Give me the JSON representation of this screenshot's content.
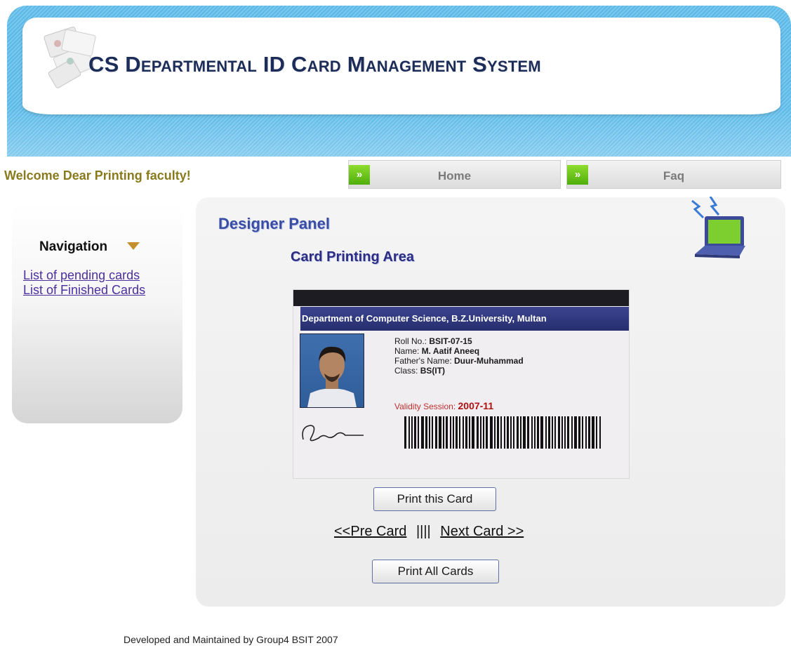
{
  "header": {
    "title": "CS Departmental ID Card Management System"
  },
  "welcome": "Welcome Dear Printing faculty!",
  "topnav": [
    {
      "label": "Home"
    },
    {
      "label": "Faq"
    }
  ],
  "sidebar": {
    "title": "Navigation",
    "links": [
      "List of pending cards",
      "List of Finished Cards"
    ]
  },
  "main": {
    "panel_title": "Designer Panel",
    "section_title": "Card Printing Area",
    "print_card_button": "Print this Card",
    "prev_link": "<<Pre Card",
    "separator": "||||",
    "next_link": "Next Card >>",
    "print_all_button": "Print All Cards"
  },
  "card": {
    "department": "Department of Computer Science, B.Z.University, Multan",
    "roll_label": "Roll No.:",
    "roll_value": "BSIT-07-15",
    "name_label": "Name:",
    "name_value": "M. Aatif Aneeq",
    "father_label": "Father's Name:",
    "father_value": "Duur-Muhammad",
    "class_label": "Class:",
    "class_value": "BS(IT)",
    "validity_label": "Validity Session:",
    "validity_value": "2007-11"
  },
  "footer": "Developed and Maintained by Group4 BSIT 2007",
  "colors": {
    "header_blue": "#5cb9e6",
    "title_navy": "#1d2d5a",
    "welcome_olive": "#8a7a1e",
    "nav_arrow_green": "#5cbc12",
    "link_purple": "#4b2f9f",
    "panel_title_blue": "#3a4da4"
  },
  "icons": {
    "nav_arrow": "double-chevron-right-icon",
    "sidebar_toggle": "triangle-down-icon",
    "decor": "laptop-icon"
  }
}
